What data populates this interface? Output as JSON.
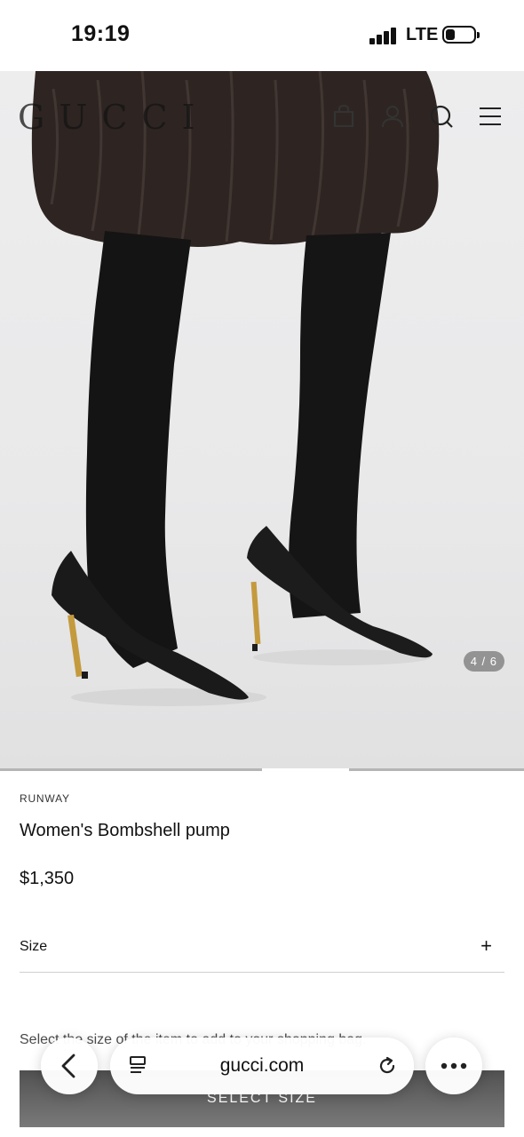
{
  "status_bar": {
    "time": "19:19",
    "network": "LTE"
  },
  "header": {
    "brand_logo": "GUCCI",
    "icons": [
      "shopping-bag-icon",
      "user-icon",
      "search-icon",
      "menu-icon"
    ]
  },
  "gallery": {
    "counter": "4 / 6",
    "current_index": 4,
    "total": 6
  },
  "product": {
    "category": "RUNWAY",
    "name": "Women's Bombshell pump",
    "price": "$1,350",
    "size_label": "Size",
    "size_toggle": "+",
    "size_hint": "Select the size of the item to add to your shopping bag.",
    "cta_label": "SELECT SIZE"
  },
  "browser": {
    "domain": "gucci.com",
    "back_icon": "chevron-left-icon",
    "reader_icon": "reader-icon",
    "reload_icon": "reload-icon",
    "more_icon": "more-dots-icon"
  }
}
